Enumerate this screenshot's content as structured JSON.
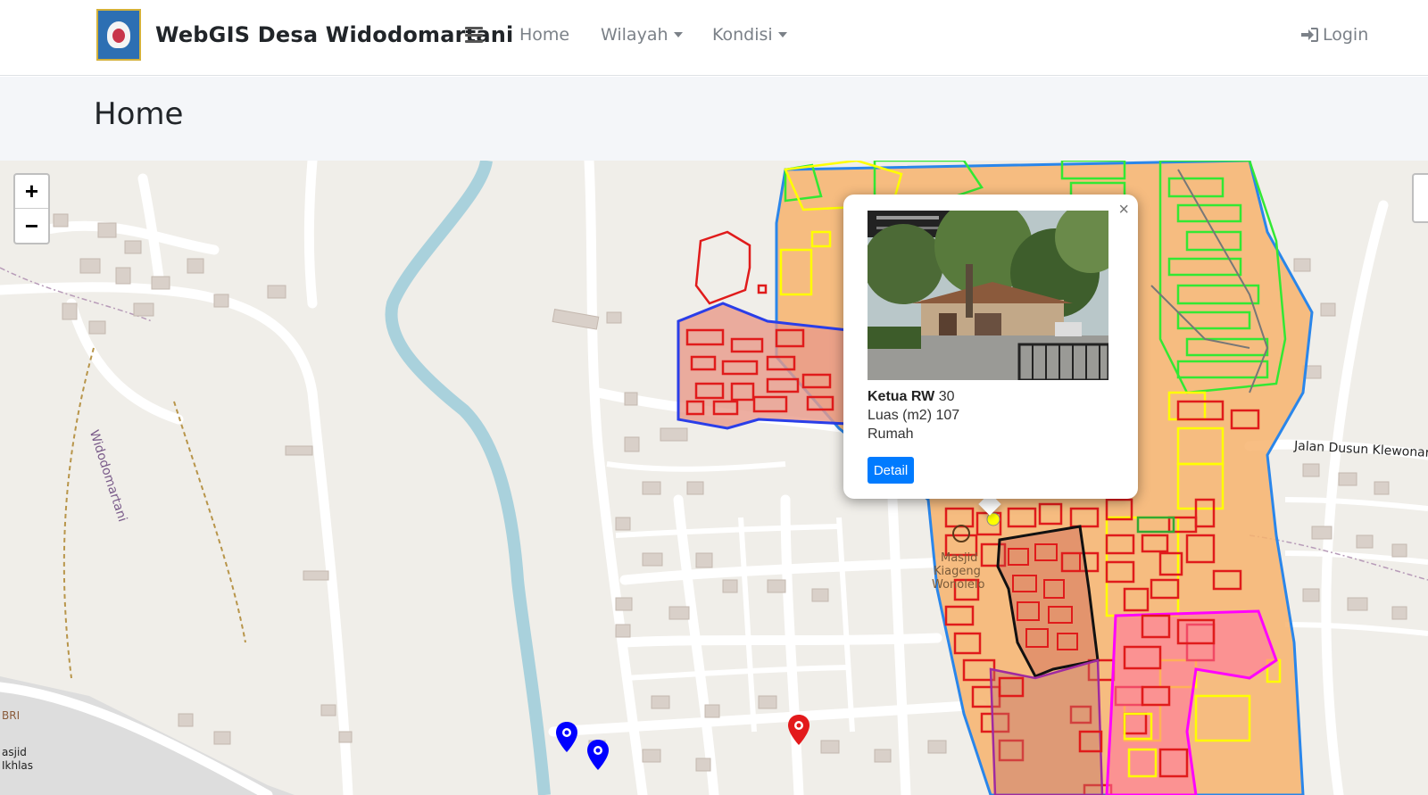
{
  "navbar": {
    "brand": "WebGIS Desa Widodomartani",
    "links": [
      {
        "label": "Home"
      },
      {
        "label": "Wilayah"
      },
      {
        "label": "Kondisi"
      }
    ],
    "login": "Login"
  },
  "header": {
    "title": "Home"
  },
  "map": {
    "zoom_in": "+",
    "zoom_out": "−",
    "labels": {
      "village_road": "Widodomartani",
      "jalan": "Jalan Dusun Klewonan",
      "masjid_1": "Masjid",
      "masjid_2": "Kiageng",
      "masjid_3": "Wonolelo",
      "bri": "BRI",
      "masjid_b1": "asjid",
      "masjid_b2": "Ikhlas"
    },
    "popup": {
      "title_label": "Ketua RW",
      "title_value": "30",
      "area_label": "Luas (m2)",
      "area_value": "107",
      "type": "Rumah",
      "button": "Detail",
      "close": "×"
    },
    "colors": {
      "water": "#a9d1dc",
      "road": "#ffffff",
      "orange_area": "#f7b36d",
      "red_outline": "#e01b1b",
      "green_outline": "#33e833",
      "yellow_outline": "#ffff00",
      "blue_outline": "#2a5dea",
      "magenta_outline": "#ff00ff",
      "marker_blue": "#0000ff",
      "marker_red": "#e31a1c"
    }
  }
}
